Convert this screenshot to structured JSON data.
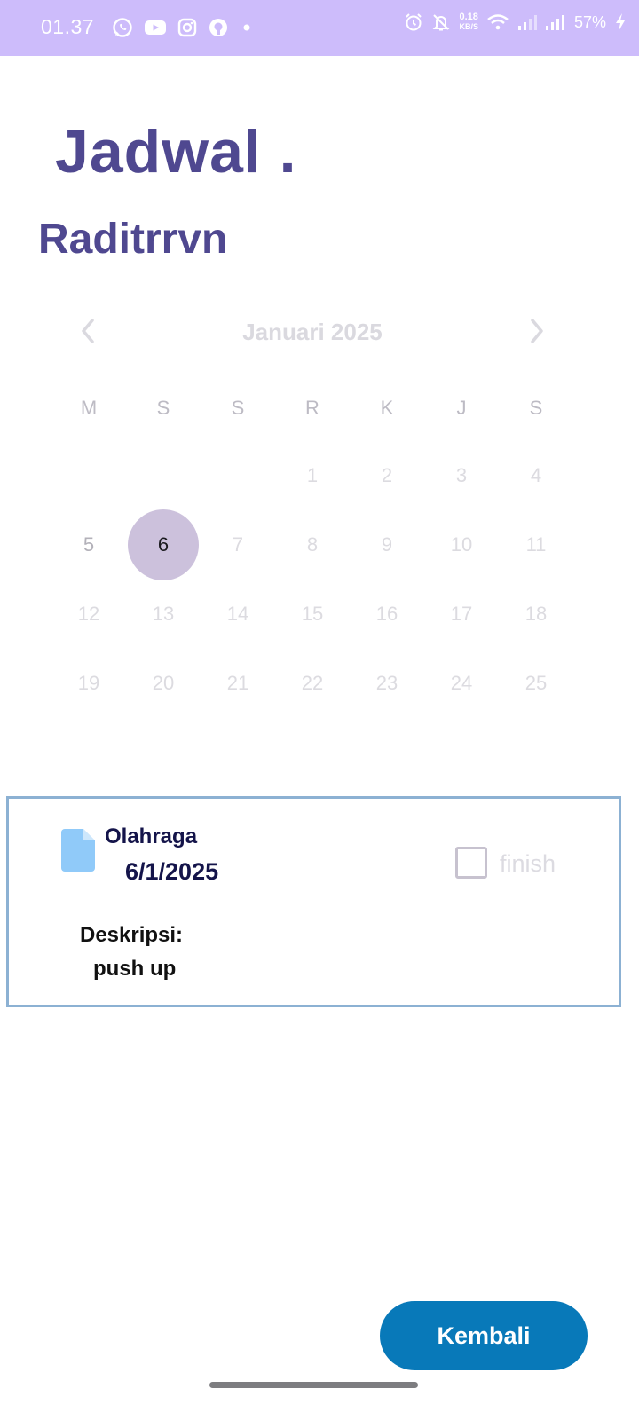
{
  "status_bar": {
    "time": "01.37",
    "net_speed_value": "0.18",
    "net_speed_unit": "KB/S",
    "battery": "57%",
    "left_icons": [
      "whatsapp-icon",
      "youtube-icon",
      "instagram-icon",
      "app-icon",
      "dot-icon"
    ],
    "right_icons": [
      "alarm-icon",
      "bell-off-icon",
      "wifi-icon",
      "signal-icon",
      "signal-icon",
      "charging-icon"
    ]
  },
  "page": {
    "title": "Jadwal .",
    "user": "Raditrrvn"
  },
  "calendar": {
    "month_label": "Januari 2025",
    "weekdays": [
      "M",
      "S",
      "S",
      "R",
      "K",
      "J",
      "S"
    ],
    "weeks": [
      [
        "",
        "",
        "",
        "1",
        "2",
        "3",
        "4"
      ],
      [
        "5",
        "6",
        "7",
        "8",
        "9",
        "10",
        "11"
      ],
      [
        "12",
        "13",
        "14",
        "15",
        "16",
        "17",
        "18"
      ],
      [
        "19",
        "20",
        "21",
        "22",
        "23",
        "24",
        "25"
      ]
    ],
    "selected_day": "6",
    "active_day": "5",
    "colors": {
      "selected_bg": "#ccc1dc",
      "faded_text": "#dcdbe0"
    }
  },
  "task": {
    "title": "Olahraga",
    "date": "6/1/2025",
    "finish_label": "finish",
    "finished": false,
    "description_label": "Deskripsi:",
    "description": "push up",
    "icon": "document-icon"
  },
  "actions": {
    "back_label": "Kembali"
  },
  "colors": {
    "status_bar": "#cdbcfb",
    "title": "#4f4890",
    "card_border": "#8cb1d3",
    "button": "#0879b9",
    "doc_icon": "#90caf9"
  }
}
